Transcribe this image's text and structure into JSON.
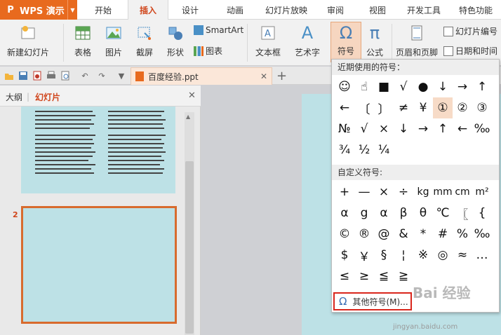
{
  "app": {
    "logo": "P",
    "name": "WPS 演示"
  },
  "menu": {
    "tabs": [
      "开始",
      "插入",
      "设计",
      "动画",
      "幻灯片放映",
      "审阅",
      "视图",
      "开发工具",
      "特色功能"
    ],
    "active_index": 1
  },
  "ribbon": {
    "new_slide": "新建幻灯片",
    "table": "表格",
    "picture": "图片",
    "screenshot": "截屏",
    "shape": "形状",
    "smartart": "SmartArt",
    "chart": "图表",
    "textbox": "文本框",
    "wordart": "艺术字",
    "symbol": "符号",
    "formula": "公式",
    "header_footer": "页眉和页脚",
    "slide_number": "幻灯片编号",
    "date_time": "日期和时间"
  },
  "doc": {
    "tab_name": "百度经验.ppt"
  },
  "panel": {
    "tab_outline": "大纲",
    "tab_slides": "幻灯片",
    "slide2_num": "2"
  },
  "popup": {
    "recent_title": "近期使用的符号：",
    "recent": [
      "☺",
      "☝",
      "■",
      "√",
      "●",
      "↓",
      "→",
      "↑",
      "←",
      "〔",
      "〕",
      "≠",
      "¥",
      "①",
      "②",
      "③",
      "№",
      "√",
      "×",
      "↓",
      "→",
      "↑",
      "←",
      "‰",
      "¾",
      "½",
      "¼"
    ],
    "custom_title": "自定义符号:",
    "custom": [
      "+",
      "—",
      "×",
      "÷",
      "kg",
      "mm",
      "cm",
      "m²",
      "α",
      "g",
      "α",
      "β",
      "θ",
      "℃",
      "〖",
      "{",
      "©",
      "®",
      "@",
      "&",
      "*",
      "#",
      "%",
      "‰",
      "$",
      "￥",
      "§",
      "¦",
      "※",
      "◎",
      "≈",
      "…",
      "≤",
      "≥",
      "≦",
      "≧"
    ],
    "more": "其他符号(M)..."
  },
  "watermark": {
    "logo": "Bai 经验",
    "url": "jingyan.baidu.com"
  },
  "colors": {
    "accent": "#e86a1e",
    "active_tab_text": "#d0451b",
    "slide_bg": "#bde1e6",
    "highlight_border": "#d9261c"
  }
}
